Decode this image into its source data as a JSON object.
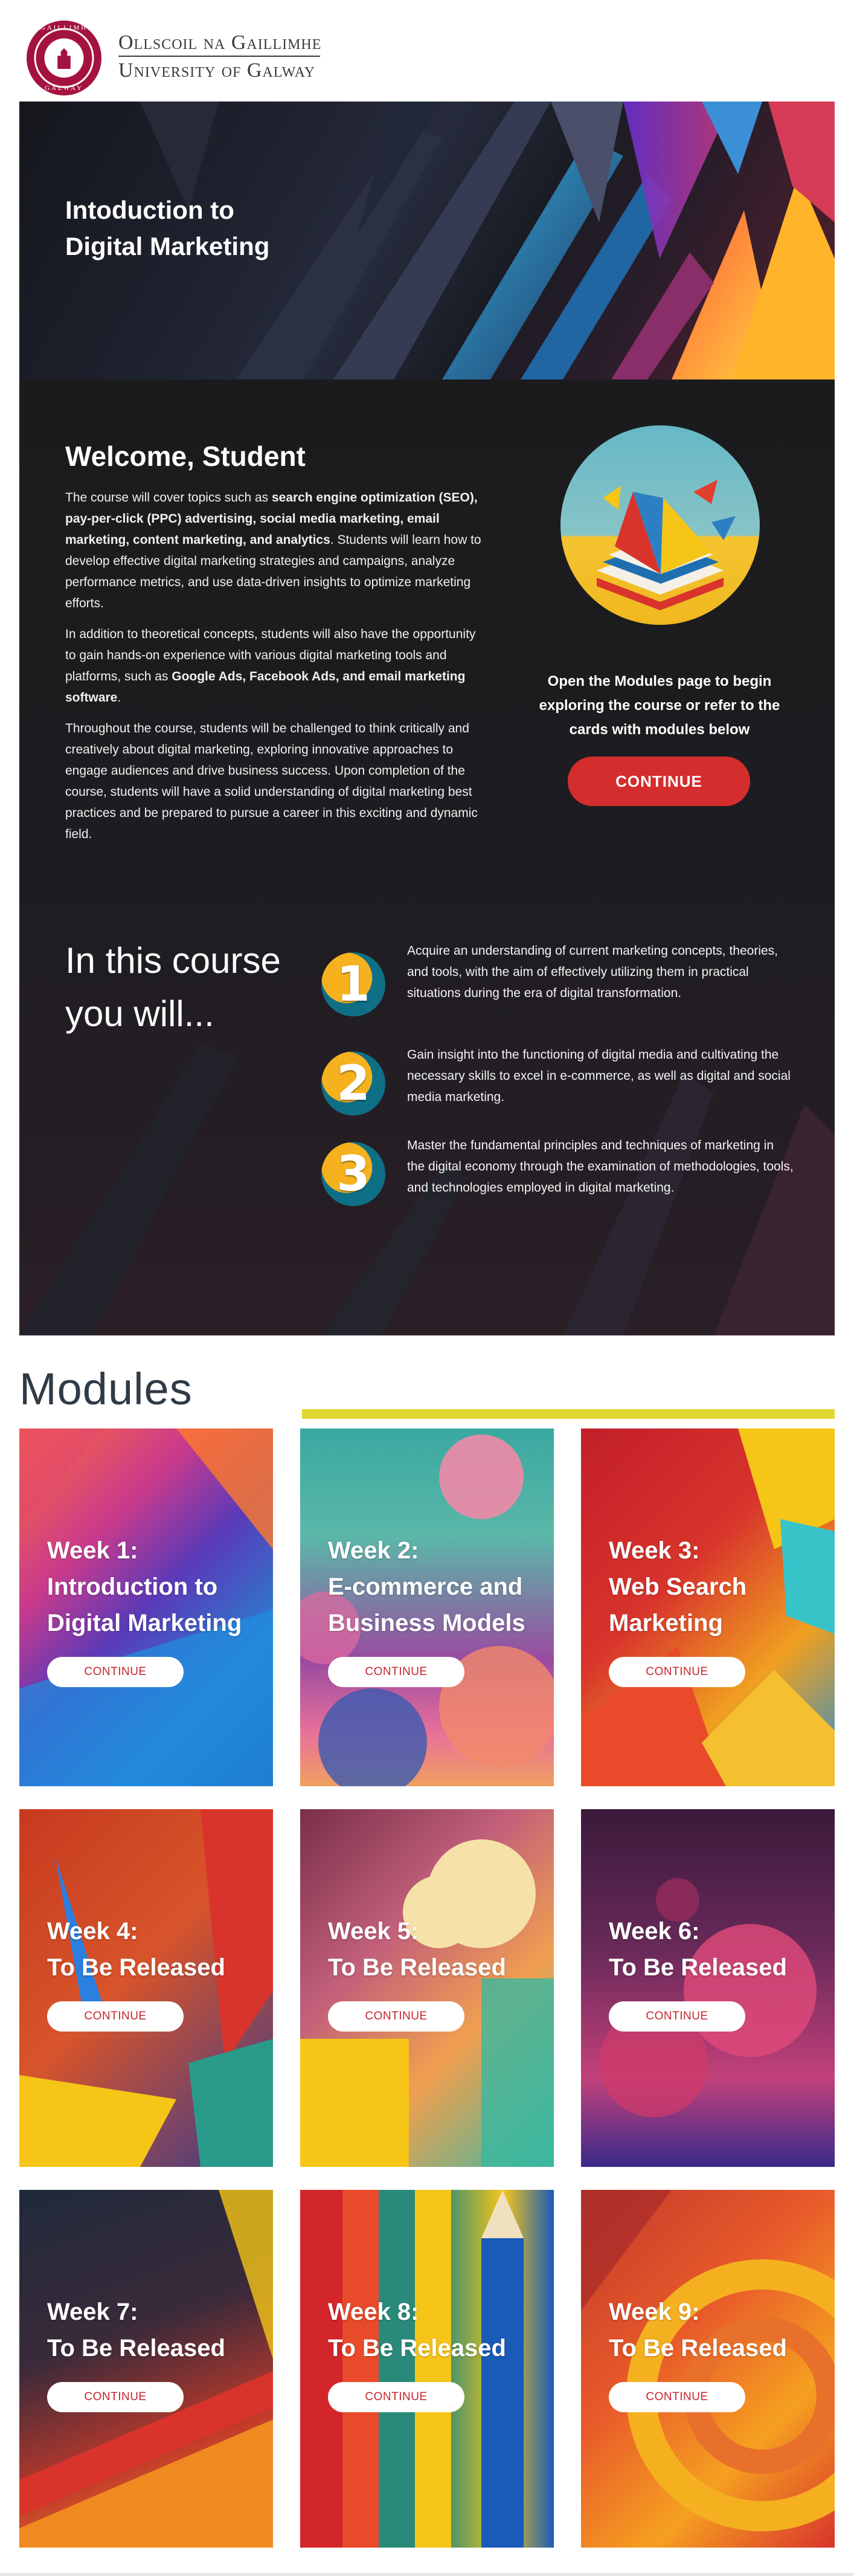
{
  "header": {
    "logo_top_text": "GAILLIMH",
    "logo_bottom_text": "GALWAY",
    "irish_name": "Ollscoil na Gaillimhe",
    "english_name": "University of Galway"
  },
  "hero": {
    "title_line1": "Intoduction to",
    "title_line2": "Digital Marketing"
  },
  "welcome": {
    "title": "Welcome, Student",
    "p1_a": "The course will cover topics such as ",
    "p1_bold": "search engine optimization (SEO), pay-per-click (PPC) advertising, social media marketing, email marketing, content marketing, and analytics",
    "p1_b": ". Students will learn how to develop effective digital marketing strategies and campaigns, analyze performance metrics, and use data-driven insights to optimize marketing efforts.",
    "p2_a": "In addition to theoretical concepts, students will also have the opportunity to gain hands-on experience with various digital marketing tools and platforms, such as ",
    "p2_bold": "Google Ads, Facebook Ads, and email marketing software",
    "p2_b": ".",
    "p3": "Throughout the course, students will be challenged to think critically and creatively about digital marketing, exploring innovative approaches to engage audiences and drive business success. Upon completion of the course, students will have a solid understanding of digital marketing best practices and be prepared to pursue a career in this exciting and dynamic field.",
    "cta_text": "Open the Modules page to begin exploring the course or refer to the cards with modules below",
    "cta_button": "CONTINUE"
  },
  "course": {
    "title_line1": "In this course",
    "title_line2": "you will...",
    "outcomes": [
      {
        "number": "1",
        "text": "Acquire an understanding of current marketing concepts, theories, and tools, with the aim of effectively utilizing them in practical situations during the era of digital transformation."
      },
      {
        "number": "2",
        "text": "Gain insight into the functioning of digital media and cultivating the necessary skills to excel in e-commerce, as well as digital and social media marketing."
      },
      {
        "number": "3",
        "text": "Master the fundamental principles and techniques of marketing in the digital economy through the examination of methodologies, tools, and technologies employed in digital marketing."
      }
    ]
  },
  "modules": {
    "heading": "Modules",
    "accent_color": "#e0d830",
    "cards": [
      {
        "week": "Week 1:",
        "line2": "Introduction to",
        "line3": "Digital Marketing",
        "button": "CONTINUE"
      },
      {
        "week": "Week 2:",
        "line2": "E-commerce and",
        "line3": "Business Models",
        "button": "CONTINUE"
      },
      {
        "week": "Week 3:",
        "line2": "Web Search",
        "line3": "Marketing",
        "button": "CONTINUE"
      },
      {
        "week": "Week 4:",
        "line2": "To Be Released",
        "button": "CONTINUE"
      },
      {
        "week": "Week 5:",
        "line2": "To Be Released",
        "button": "CONTINUE"
      },
      {
        "week": "Week 6:",
        "line2": "To Be Released",
        "button": "CONTINUE"
      },
      {
        "week": "Week 7:",
        "line2": "To Be Released",
        "button": "CONTINUE"
      },
      {
        "week": "Week 8:",
        "line2": "To Be Released",
        "button": "CONTINUE"
      },
      {
        "week": "Week 9:",
        "line2": "To Be Released",
        "button": "CONTINUE"
      }
    ]
  },
  "colors": {
    "brand_maroon": "#a4123f",
    "cta_red": "#d42d2d",
    "dark_bg": "#1b1b1d"
  }
}
